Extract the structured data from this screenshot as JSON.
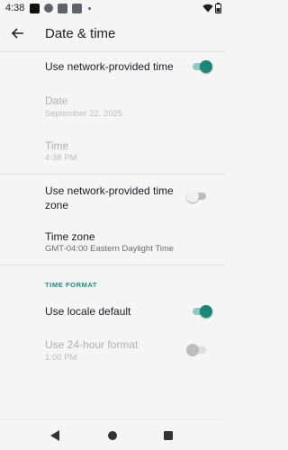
{
  "status_bar": {
    "time": "4:38"
  },
  "app_bar": {
    "title": "Date & time",
    "back_icon": "arrow-back-icon"
  },
  "settings": {
    "network_time": {
      "label": "Use network-provided time",
      "enabled": true
    },
    "date": {
      "label": "Date",
      "value": "September 22, 2025",
      "disabled": true
    },
    "time": {
      "label": "Time",
      "value": "4:38 PM",
      "disabled": true
    },
    "network_zone": {
      "label_line1": "Use network-provided time",
      "label_line2": "zone",
      "enabled": false
    },
    "time_zone": {
      "label": "Time zone",
      "value": "GMT-04:00 Eastern Daylight Time"
    },
    "time_format_header": "TIME FORMAT",
    "locale_default": {
      "label": "Use locale default",
      "enabled": true
    },
    "use_24h": {
      "label": "Use 24-hour format",
      "value": "1:00 PM",
      "enabled": false,
      "disabled": true
    }
  },
  "colors": {
    "accent": "#168779",
    "accent_track": "#8fc9c0",
    "section_header": "#1a8a7d",
    "background": "#f5f5f5"
  }
}
